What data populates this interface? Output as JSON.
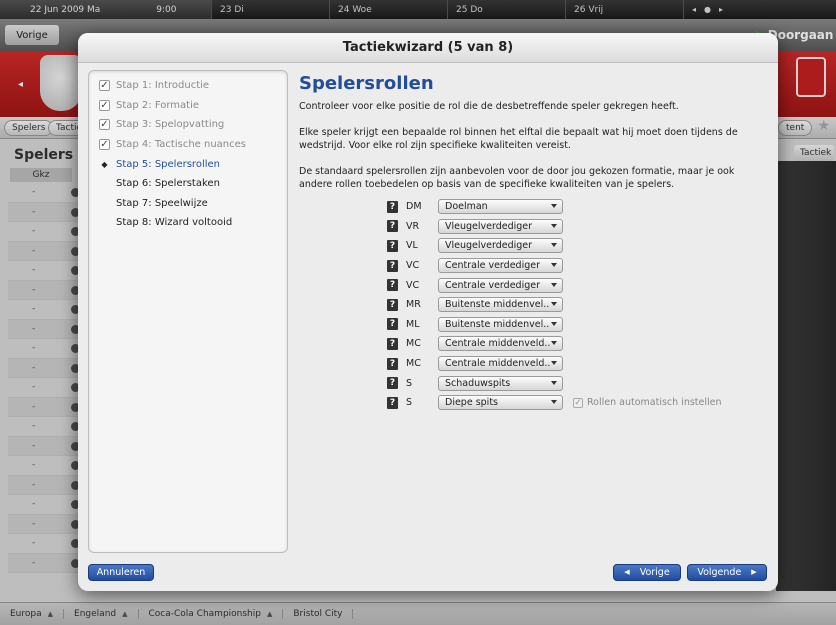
{
  "topbar": {
    "date": "22 Jun 2009 Ma",
    "time": "9:00",
    "days": [
      "23 Di",
      "24 Woe",
      "25 Do",
      "26 Vrij"
    ]
  },
  "navbar": {
    "back_label": "Vorige",
    "continue_label": "Doorgaan"
  },
  "subnav": {
    "tabs": [
      "Spelers",
      "Tactie",
      "tent"
    ]
  },
  "bg_main": {
    "title": "Spelers -",
    "column_header": "Gkz",
    "row_value": "-",
    "tactic_button": "Tactiek"
  },
  "footer": {
    "breadcrumbs": [
      "Europa",
      "Engeland",
      "Coca-Cola Championship",
      "Bristol City"
    ]
  },
  "dialog": {
    "title": "Tactiekwizard (5 van 8)",
    "steps": [
      {
        "label": "Stap 1: Introductie",
        "state": "done"
      },
      {
        "label": "Stap 2: Formatie",
        "state": "done"
      },
      {
        "label": "Stap 3: Spelopvatting",
        "state": "done"
      },
      {
        "label": "Stap 4: Tactische nuances",
        "state": "done"
      },
      {
        "label": "Stap 5: Spelersrollen",
        "state": "current"
      },
      {
        "label": "Stap 6: Spelerstaken",
        "state": "todo"
      },
      {
        "label": "Stap 7: Speelwijze",
        "state": "todo"
      },
      {
        "label": "Stap 8: Wizard voltooid",
        "state": "todo"
      }
    ],
    "heading": "Spelersrollen",
    "paragraphs": [
      "Controleer voor elke positie de rol die de desbetreffende speler gekregen heeft.",
      "Elke speler krijgt een bepaalde rol binnen het elftal die bepaalt wat hij moet doen tijdens de wedstrijd. Voor elke rol zijn specifieke kwaliteiten vereist.",
      "De standaard spelersrollen zijn aanbevolen voor de door jou gekozen formatie, maar je ook andere rollen toebedelen op basis van de specifieke kwaliteiten van je spelers."
    ],
    "help_glyph": "?",
    "roles": [
      {
        "position": "DM",
        "role": "Doelman"
      },
      {
        "position": "VR",
        "role": "Vleugelverdediger"
      },
      {
        "position": "VL",
        "role": "Vleugelverdediger"
      },
      {
        "position": "VC",
        "role": "Centrale verdediger"
      },
      {
        "position": "VC",
        "role": "Centrale verdediger"
      },
      {
        "position": "MR",
        "role": "Buitenste middenvel.."
      },
      {
        "position": "ML",
        "role": "Buitenste middenvel.."
      },
      {
        "position": "MC",
        "role": "Centrale middenveld.."
      },
      {
        "position": "MC",
        "role": "Centrale middenveld.."
      },
      {
        "position": "S",
        "role": "Schaduwspits"
      },
      {
        "position": "S",
        "role": "Diepe spits"
      }
    ],
    "auto_roles_label": "Rollen automatisch instellen",
    "auto_roles_checked": true,
    "buttons": {
      "cancel": "Annuleren",
      "previous": "Vorige",
      "next": "Volgende"
    }
  }
}
